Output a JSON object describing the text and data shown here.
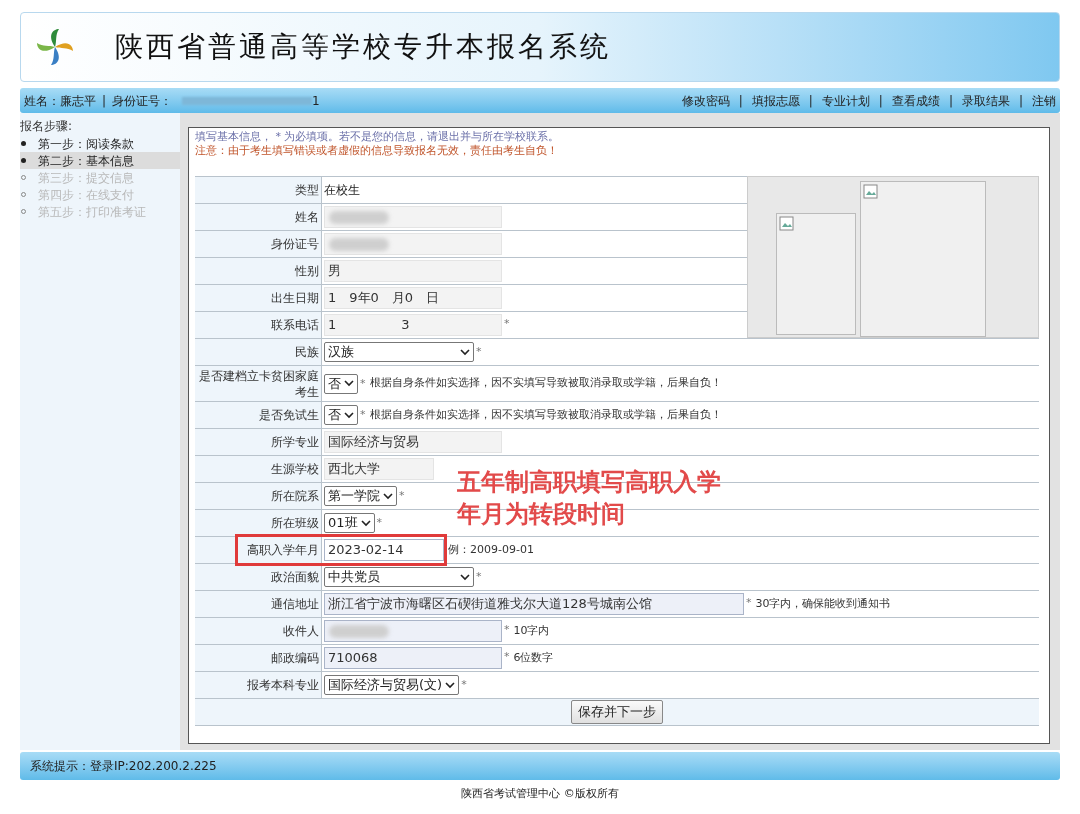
{
  "header": {
    "title": "陕西省普通高等学校专升本报名系统"
  },
  "user_bar": {
    "name_label": "姓名：",
    "name": "廉志平",
    "separator": "|",
    "id_label": "身份证号：",
    "id_tail": "1",
    "id_redacted": true
  },
  "nav": [
    {
      "label": "修改密码"
    },
    {
      "label": "填报志愿"
    },
    {
      "label": "专业计划"
    },
    {
      "label": "查看成绩"
    },
    {
      "label": "录取结果"
    },
    {
      "label": "注销"
    }
  ],
  "nav_separator": "|",
  "sidebar": {
    "title": "报名步骤:",
    "items": [
      {
        "label": "第一步：阅读条款",
        "done": true,
        "selected": false
      },
      {
        "label": "第二步：基本信息",
        "done": true,
        "selected": true
      },
      {
        "label": "第三步：提交信息",
        "done": false,
        "selected": false
      },
      {
        "label": "第四步：在线支付",
        "done": false,
        "selected": false
      },
      {
        "label": "第五步：打印准考证",
        "done": false,
        "selected": false
      }
    ]
  },
  "notice": {
    "line1": "填写基本信息， * 为必填项。若不是您的信息，请退出并与所在学校联系。",
    "line2": "注意：由于考生填写错误或者虚假的信息导致报名无效，责任由考生自负！"
  },
  "form": {
    "rows": [
      {
        "label": "类型",
        "kind": "text",
        "value": "在校生"
      },
      {
        "label": "姓名",
        "kind": "input",
        "value": "",
        "redacted": true
      },
      {
        "label": "身份证号",
        "kind": "input",
        "value": "",
        "redacted": true
      },
      {
        "label": "性别",
        "kind": "input",
        "value": "男"
      },
      {
        "label": "出生日期",
        "kind": "input",
        "value": "1　9年0　月0　日"
      },
      {
        "label": "联系电话",
        "kind": "input",
        "value": "1　　　　　3",
        "required": true
      },
      {
        "label": "民族",
        "kind": "select",
        "value": "汉族",
        "required": true
      },
      {
        "label": "是否建档立卡贫困家庭考生",
        "kind": "select",
        "value": "否",
        "required": true,
        "hint": "根据自身条件如实选择，因不实填写导致被取消录取或学籍，后果自负！"
      },
      {
        "label": "是否免试生",
        "kind": "select",
        "value": "否",
        "required": true,
        "hint": "根据自身条件如实选择，因不实填写导致被取消录取或学籍，后果自负！"
      },
      {
        "label": "所学专业",
        "kind": "input",
        "value": "国际经济与贸易"
      },
      {
        "label": "生源学校",
        "kind": "input",
        "value": "西北大学"
      },
      {
        "label": "所在院系",
        "kind": "select",
        "value": "第一学院",
        "required": true
      },
      {
        "label": "所在班级",
        "kind": "select",
        "value": "01班",
        "required": true
      },
      {
        "label": "高职入学年月",
        "kind": "input",
        "value": "2023-02-14",
        "hint": "例：2009-09-01",
        "highlighted": true,
        "editable": true
      },
      {
        "label": "政治面貌",
        "kind": "select",
        "value": "中共党员",
        "required": true
      },
      {
        "label": "通信地址",
        "kind": "input",
        "value": "浙江省宁波市海曙区石碶街道雅戈尔大道128号城南公馆",
        "required": true,
        "hint": "30字内，确保能收到通知书",
        "editable": true
      },
      {
        "label": "收件人",
        "kind": "input",
        "value": "",
        "redacted": true,
        "required": true,
        "hint": "10字内",
        "editable": true
      },
      {
        "label": "邮政编码",
        "kind": "input",
        "value": "710068",
        "required": true,
        "hint": "6位数字",
        "editable": true
      },
      {
        "label": "报考本科专业",
        "kind": "select",
        "value": "国际经济与贸易(文)",
        "required": true
      }
    ],
    "required_mark": "*",
    "submit": "保存并下一步"
  },
  "annotation": {
    "lines": [
      "五年制高职填写高职入学",
      "年月为转段时间"
    ]
  },
  "status_bar": {
    "label": "系统提示：",
    "text": "登录IP:202.200.2.225"
  },
  "footer": "陕西省考试管理中心 ©版权所有"
}
